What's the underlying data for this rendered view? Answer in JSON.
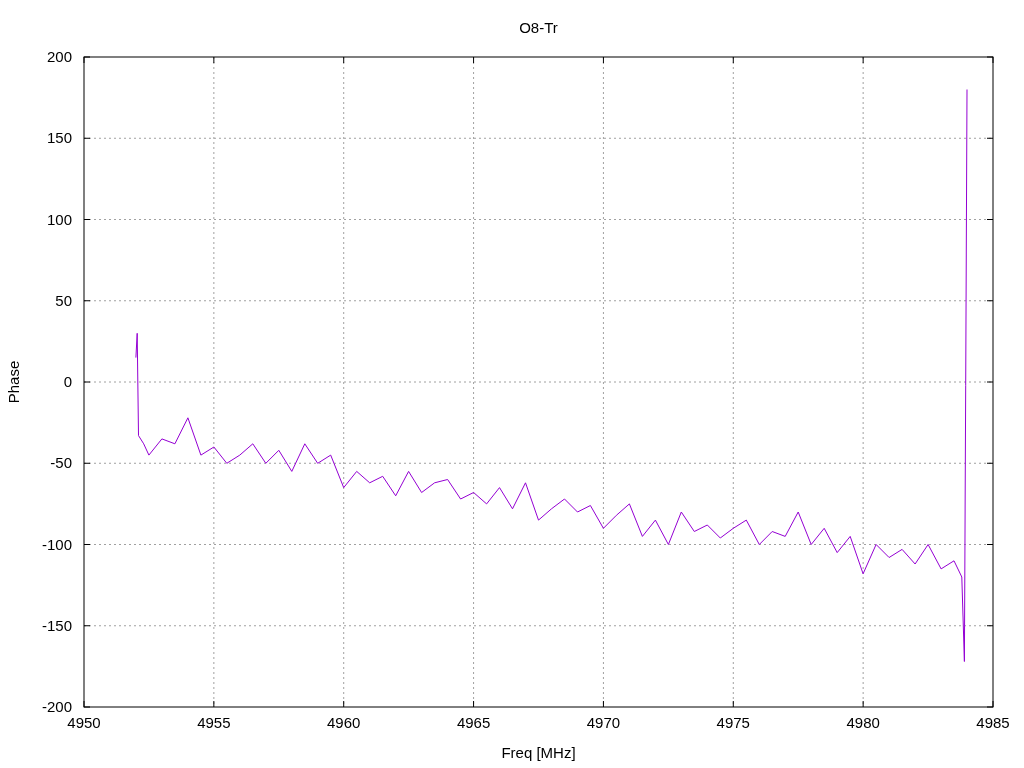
{
  "chart": {
    "chart_data": {
      "type": "line",
      "title": "O8-Tr",
      "xlabel": "Freq [MHz]",
      "ylabel": "Phase",
      "x": [
        4952,
        4952.05,
        4952.1,
        4952.3,
        4952.5,
        4953,
        4953.5,
        4954,
        4954.5,
        4955,
        4955.5,
        4956,
        4956.5,
        4957,
        4957.5,
        4958,
        4958.5,
        4959,
        4959.5,
        4960,
        4960.5,
        4961,
        4961.5,
        4962,
        4962.5,
        4963,
        4963.5,
        4964,
        4964.5,
        4965,
        4965.5,
        4966,
        4966.5,
        4967,
        4967.5,
        4968,
        4968.5,
        4969,
        4969.5,
        4970,
        4970.5,
        4971,
        4971.5,
        4972,
        4972.5,
        4973,
        4973.5,
        4974,
        4974.5,
        4975,
        4975.5,
        4976,
        4976.5,
        4977,
        4977.5,
        4978,
        4978.5,
        4979,
        4979.5,
        4980,
        4980.5,
        4981,
        4981.5,
        4982,
        4982.5,
        4983,
        4983.5,
        4983.8,
        4983.9,
        4983.95,
        4984
      ],
      "grid": true,
      "series": [
        {
          "color": "#9400d3",
          "values": [
            15,
            30,
            -33,
            -38,
            -45,
            -35,
            -38,
            -22,
            -45,
            -40,
            -50,
            -45,
            -38,
            -50,
            -42,
            -55,
            -38,
            -50,
            -45,
            -65,
            -55,
            -62,
            -58,
            -70,
            -55,
            -68,
            -62,
            -60,
            -72,
            -68,
            -75,
            -65,
            -78,
            -62,
            -85,
            -78,
            -72,
            -80,
            -76,
            -90,
            -82,
            -75,
            -95,
            -85,
            -100,
            -80,
            -92,
            -88,
            -96,
            -90,
            -85,
            -100,
            -92,
            -95,
            -80,
            -100,
            -90,
            -105,
            -95,
            -118,
            -100,
            -108,
            -103,
            -112,
            -100,
            -115,
            -110,
            -120,
            -172,
            -2,
            180
          ]
        }
      ],
      "xlim": [
        4950,
        4985
      ],
      "ylim": [
        -200,
        200
      ],
      "xticks": [
        4950,
        4955,
        4960,
        4965,
        4970,
        4975,
        4980,
        4985
      ],
      "yticks": [
        -200,
        -150,
        -100,
        -50,
        0,
        50,
        100,
        150,
        200
      ]
    }
  }
}
